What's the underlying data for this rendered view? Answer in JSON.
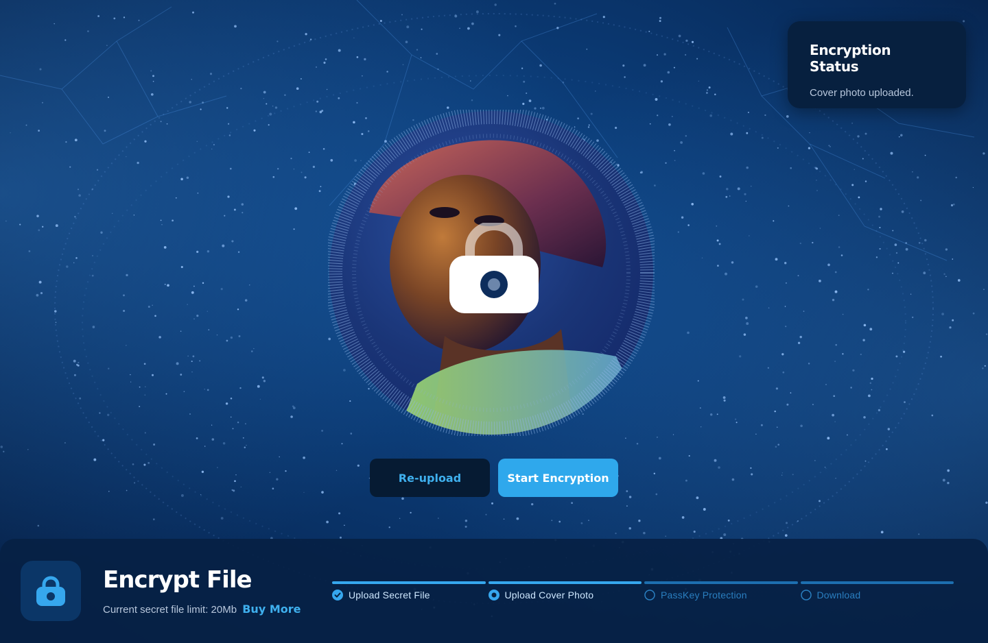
{
  "status": {
    "title": "Encryption Status",
    "message": "Cover photo uploaded."
  },
  "photo": {
    "icon": "lock-icon",
    "watermark": "Unsplash+"
  },
  "actions": {
    "reupload_label": "Re-upload",
    "start_label": "Start Encryption"
  },
  "panel": {
    "title": "Encrypt File",
    "limit_text": "Current secret file limit: 20Mb",
    "buy_more_label": "Buy More",
    "icon": "lock-icon"
  },
  "steps": [
    {
      "label": "Upload Secret File",
      "state": "done"
    },
    {
      "label": "Upload Cover Photo",
      "state": "active"
    },
    {
      "label": "PassKey Protection",
      "state": "todo"
    },
    {
      "label": "Download",
      "state": "todo"
    }
  ],
  "colors": {
    "accent": "#2fa8ec",
    "background": "#0b3a74",
    "panel": "#07213f"
  }
}
